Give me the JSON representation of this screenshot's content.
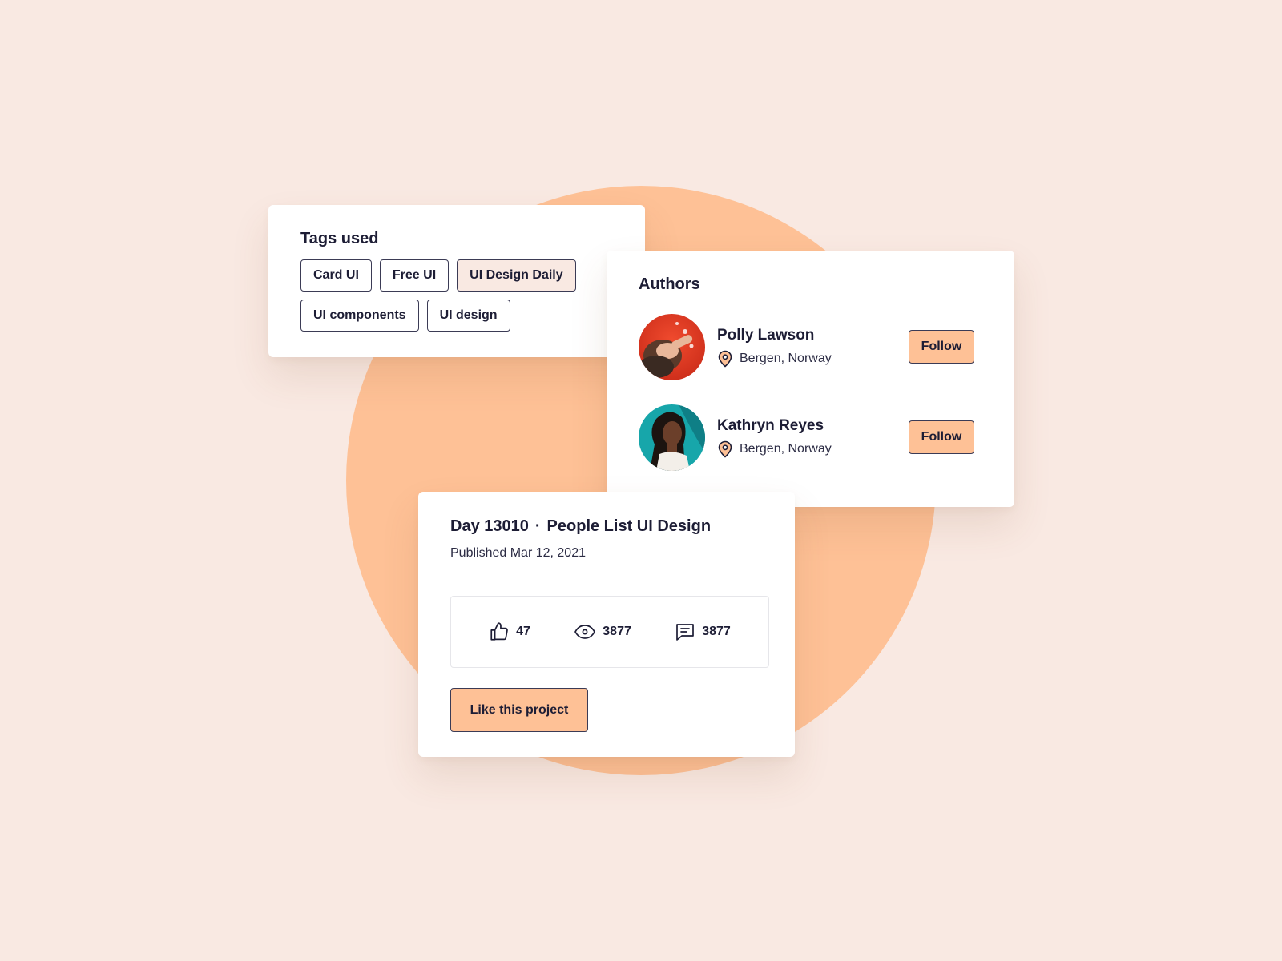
{
  "colors": {
    "background": "#f9e9e2",
    "accent": "#fec196",
    "text": "#1d1d35",
    "border": "#3b3b55"
  },
  "tags_card": {
    "title": "Tags used",
    "tags": [
      {
        "label": "Card UI",
        "selected": false
      },
      {
        "label": "Free UI",
        "selected": false
      },
      {
        "label": "UI Design Daily",
        "selected": true
      },
      {
        "label": "UI components",
        "selected": false
      },
      {
        "label": "UI design",
        "selected": false
      }
    ]
  },
  "authors_card": {
    "title": "Authors",
    "authors": [
      {
        "name": "Polly Lawson",
        "location": "Bergen, Norway",
        "follow_label": "Follow",
        "icon": "map-pin-icon"
      },
      {
        "name": "Kathryn Reyes",
        "location": "Bergen, Norway",
        "follow_label": "Follow",
        "icon": "map-pin-icon"
      }
    ]
  },
  "post_card": {
    "day": "Day 13010",
    "separator": "·",
    "title": "People List UI Design",
    "published": "Published Mar 12, 2021",
    "stats": {
      "likes": "47",
      "views": "3877",
      "comments": "3877"
    },
    "like_button": "Like this project"
  }
}
